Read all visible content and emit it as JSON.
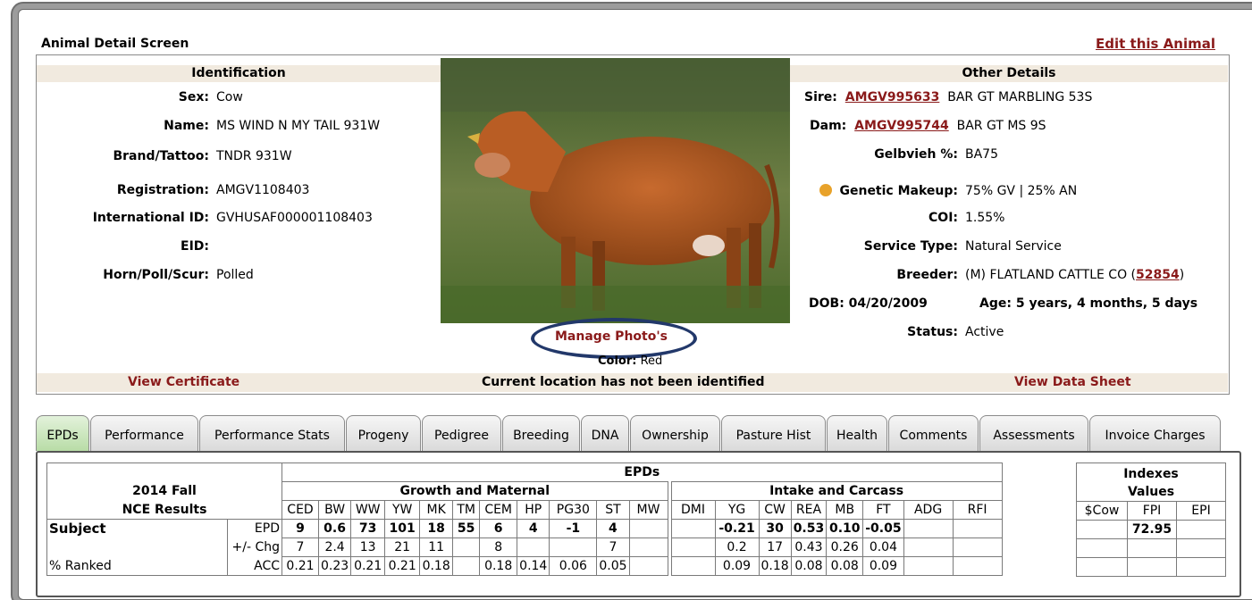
{
  "screen_title": "Animal Detail Screen",
  "edit_label": "Edit this Animal",
  "identification": {
    "heading": "Identification",
    "rows": [
      {
        "label": "Sex:",
        "value": "Cow"
      },
      {
        "label": "Name:",
        "value": "MS WIND N MY TAIL 931W"
      },
      {
        "label": "Brand/Tattoo:",
        "value": "TNDR 931W"
      },
      {
        "label": "Registration:",
        "value": "AMGV1108403"
      },
      {
        "label": "International ID:",
        "value": "GVHUSAF000001108403"
      },
      {
        "label": "EID:",
        "value": ""
      },
      {
        "label": "Horn/Poll/Scur:",
        "value": "Polled"
      }
    ]
  },
  "photo": {
    "manage_label": "Manage Photo's",
    "color_label": "Color:",
    "color_value": "Red"
  },
  "other": {
    "heading": "Other Details",
    "sire_label": "Sire:",
    "sire_id": "AMGV995633",
    "sire_name": "BAR GT MARBLING 53S",
    "dam_label": "Dam:",
    "dam_id": "AMGV995744",
    "dam_name": "BAR GT MS 9S",
    "gelbvieh_label": "Gelbvieh %:",
    "gelbvieh_value": "BA75",
    "genetic_label": "Genetic Makeup:",
    "genetic_value": "75% GV | 25% AN",
    "coi_label": "COI:",
    "coi_value": "1.55%",
    "service_label": "Service Type:",
    "service_value": "Natural Service",
    "breeder_label": "Breeder:",
    "breeder_value": "(M) FLATLAND CATTLE CO (",
    "breeder_id": "52854",
    "breeder_close": ")",
    "dob": "DOB: 04/20/2009",
    "age": "Age: 5 years, 4 months, 5 days",
    "status_label": "Status:",
    "status_value": "Active"
  },
  "bottom_bar": {
    "view_certificate": "View Certificate",
    "location": "Current location has not been identified",
    "view_data_sheet": "View Data Sheet"
  },
  "tabs": [
    "EPDs",
    "Performance",
    "Performance Stats",
    "Progeny",
    "Pedigree",
    "Breeding",
    "DNA",
    "Ownership",
    "Pasture Hist",
    "Health",
    "Comments",
    "Assessments",
    "Invoice Charges"
  ],
  "epd_table": {
    "epds_heading": "EPDs",
    "season": "2014 Fall",
    "nce": "NCE Results",
    "growth_heading": "Growth and Maternal",
    "intake_heading": "Intake and Carcass",
    "growth_cols": [
      "CED",
      "BW",
      "WW",
      "YW",
      "MK",
      "TM",
      "CEM",
      "HP",
      "PG30",
      "ST",
      "MW"
    ],
    "intake_cols": [
      "DMI",
      "YG",
      "CW",
      "REA",
      "MB",
      "FT",
      "ADG",
      "RFI"
    ],
    "subject_label": "Subject",
    "ranked_label": "% Ranked",
    "row_labels": [
      "EPD",
      "+/- Chg",
      "ACC"
    ],
    "growth_epd": [
      "9",
      "0.6",
      "73",
      "101",
      "18",
      "55",
      "6",
      "4",
      "-1",
      "4",
      ""
    ],
    "growth_chg": [
      "7",
      "2.4",
      "13",
      "21",
      "11",
      "",
      "8",
      "",
      "",
      "7",
      ""
    ],
    "growth_acc": [
      "0.21",
      "0.23",
      "0.21",
      "0.21",
      "0.18",
      "",
      "0.18",
      "0.14",
      "0.06",
      "0.05",
      ""
    ],
    "intake_epd": [
      "",
      "-0.21",
      "30",
      "0.53",
      "0.10",
      "-0.05",
      "",
      ""
    ],
    "intake_chg": [
      "",
      "0.2",
      "17",
      "0.43",
      "0.26",
      "0.04",
      "",
      ""
    ],
    "intake_acc": [
      "",
      "0.09",
      "0.18",
      "0.08",
      "0.08",
      "0.09",
      "",
      ""
    ]
  },
  "indexes": {
    "heading1": "Indexes",
    "heading2": "Values",
    "cols": [
      "$Cow",
      "FPI",
      "EPI"
    ],
    "values": [
      "",
      "72.95",
      ""
    ]
  }
}
